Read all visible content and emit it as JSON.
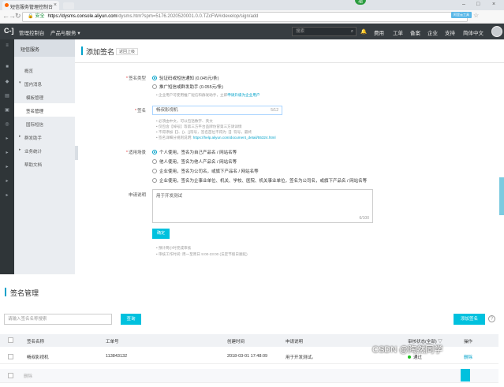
{
  "browser": {
    "tab_title": "短信服务管理控制台",
    "tab_badge": "48",
    "url_security_label": "安全",
    "url_host": "https://dysms.console.aliyun.com",
    "url_path": "/dysms.htm?spm=5176.2020520001.0.0.TZcFW#/develop/sign/add",
    "extension_label": "阿里云工具"
  },
  "topbar": {
    "logo": "C-]",
    "console": "管理控制台",
    "products": "产品与服务",
    "search_placeholder": "搜索",
    "links": [
      "费用",
      "工单",
      "备案",
      "企业",
      "支持",
      "简体中文"
    ]
  },
  "submenu": {
    "title": "短信服务",
    "items": [
      {
        "label": "概览"
      },
      {
        "label": "国内消息"
      },
      {
        "label": "模板管理"
      },
      {
        "label": "签名管理"
      },
      {
        "label": "国际短信"
      },
      {
        "label": "群发助手"
      },
      {
        "label": "业务统计"
      },
      {
        "label": "帮助文档"
      }
    ]
  },
  "page": {
    "title": "添加签名",
    "back": "返回上级"
  },
  "form": {
    "sign_type_label": "签名类型",
    "sign_type_options": [
      "验证码或短信通知 (0.045元/条)",
      "推广短信或群发助手 (0.055元/条)"
    ],
    "sign_type_hint_prefix": "企业用户可使用推广短信和群发助手，立即",
    "sign_type_hint_link": "申请升级为企业用户",
    "sign_label": "签名",
    "sign_value": "畅叔影视机",
    "sign_count": "5/12",
    "sign_hints": [
      "必须由中文，可以包括数字、英文",
      "仅包含【绰号】等第三方平台品牌仿冒第三方请详情",
      "不得添加【】、()、[]符号，签名首位不得为【】符号，最终",
      "签名详细分规则说明:"
    ],
    "sign_hint_link": "https://help.aliyun.com/document_detail/55324.html",
    "purpose_label": "适用场景",
    "purpose_options": [
      "个人使用，签名为自己产品名 / 网站名等",
      "他人使用，签名为他人产品名 / 网站名等",
      "企业使用，签名为公司名，或旗下产品名 / 网站名等",
      "企业使用，签名为企事业单位、机关、学校、医院、机关事业单位，签名为公司名，或旗下产品名 / 网站名等"
    ],
    "desc_label": "申请说明",
    "desc_value": "用于开发测试",
    "desc_count": "6/100",
    "submit": "确定",
    "footer_hints": [
      "预计两小时完成审核",
      "审核工作时间: 周一至周日 9:00-23:00 (法定节假日顺延)"
    ]
  },
  "manage": {
    "title": "签名管理",
    "search_placeholder": "请输入签名名称搜索",
    "search_button": "查询",
    "add_button": "添加签名",
    "help": "?",
    "columns": [
      "签名名称",
      "工单号",
      "创建时间",
      "申请说明",
      "审核状态(全部)",
      "操作"
    ],
    "rows": [
      {
        "name": "畅叔影视机",
        "ticket": "113843132",
        "created": "2018-03-01 17:48:09",
        "desc": "用于开发测试。",
        "status": "通过",
        "action": "删除"
      }
    ],
    "footer_label": "删除"
  },
  "watermark": "CSDN @陶然同学",
  "colors": {
    "accent": "#00c1de",
    "topbar": "#373d41",
    "link": "#00a2ca",
    "required": "#e4393c",
    "status_ok": "#1dc11d"
  }
}
